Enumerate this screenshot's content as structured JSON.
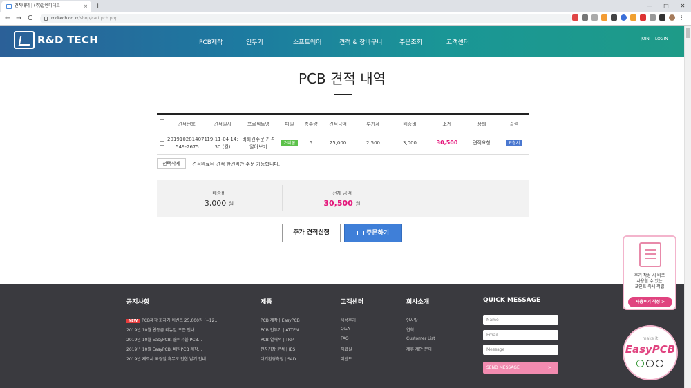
{
  "browser": {
    "tab_title": "견적내역 | (주)알엔디테크",
    "tab_close": "×",
    "new_tab": "+",
    "url_host": "rndtech.co.kr",
    "url_path": "/shop/cart.pcb.php",
    "back": "←",
    "forward": "→",
    "reload": "C",
    "win_min": "—",
    "win_max": "□",
    "win_close": "✕"
  },
  "header": {
    "logo_text": "R&D TECH",
    "menu": [
      "PCB제작",
      "인두기",
      "소프트웨어",
      "견적 & 장바구니",
      "주문조회",
      "고객센터"
    ],
    "join": "JOIN",
    "login": "LOGIN"
  },
  "page": {
    "title": "PCB 견적 내역"
  },
  "table": {
    "headers": [
      "견적번호",
      "견적일시",
      "프로젝트명",
      "파일",
      "총수량",
      "견적금액",
      "부가세",
      "배송비",
      "소계",
      "상태",
      "출력"
    ],
    "row": {
      "quote_no_1": "2019102814071",
      "quote_no_2": "549-2675",
      "date_1": "19-11-04 14:",
      "date_2": "30 (월)",
      "project_1": "비회원주문 가격",
      "project_2": "알아보기",
      "file": "거버봄",
      "qty": "5",
      "amount": "25,000",
      "vat": "2,500",
      "shipping": "3,000",
      "subtotal": "30,500",
      "status": "견적요청",
      "print": "요청서"
    }
  },
  "actions": {
    "delete_selected": "선택삭제",
    "note": "견적완료된 견적 한건씩만 주문 가능합니다."
  },
  "summary": {
    "shipping_label": "배송비",
    "shipping_value": "3,000",
    "total_label": "전체 금액",
    "total_value": "30,500",
    "unit": "원"
  },
  "buttons": {
    "add_quote": "추가 견적신청",
    "order": "주문하기"
  },
  "footer": {
    "notice_title": "공지사항",
    "new_badge": "NEW",
    "notices": [
      "PCB제작 회차가 이벤트 25,000원 (~12…",
      "2019년 10월 웹등급 리뉴얼 오픈 안내",
      "2019년 10월 EasyPCB, 출력서블 PCB…",
      "2019년 10월 EasyPCB, 배팅PCB 제작…",
      "2019년 제조사 국경절 휴무로 인한 납기 안내 …"
    ],
    "products_title": "제품",
    "products": [
      "PCB 제작 | EasyPCB",
      "PCB 인두기 | ATTEN",
      "PCB 열해석 | TRM",
      "전자기장 분석 | IES",
      "대기환경측정 | S4D"
    ],
    "support_title": "고객센터",
    "support": [
      "사용후기",
      "Q&A",
      "FAQ",
      "자료실",
      "이벤트"
    ],
    "company_title": "회사소개",
    "company": [
      "인사말",
      "연혁",
      "Customer List",
      "제휴 제안 문의"
    ],
    "quick_title": "QUICK MESSAGE",
    "name_placeholder": "Name",
    "email_placeholder": "Email",
    "message_placeholder": "Message",
    "send": "SEND MESSAGE",
    "send_arrow": ">"
  },
  "floating": {
    "review_line1": "후기 작성 시 바로",
    "review_line2": "사용할 수 있는",
    "review_line3": "포인트 즉시 적립",
    "review_button": "사용후기 작성 >",
    "make_it": "make it",
    "brand": "EasyPCB"
  }
}
